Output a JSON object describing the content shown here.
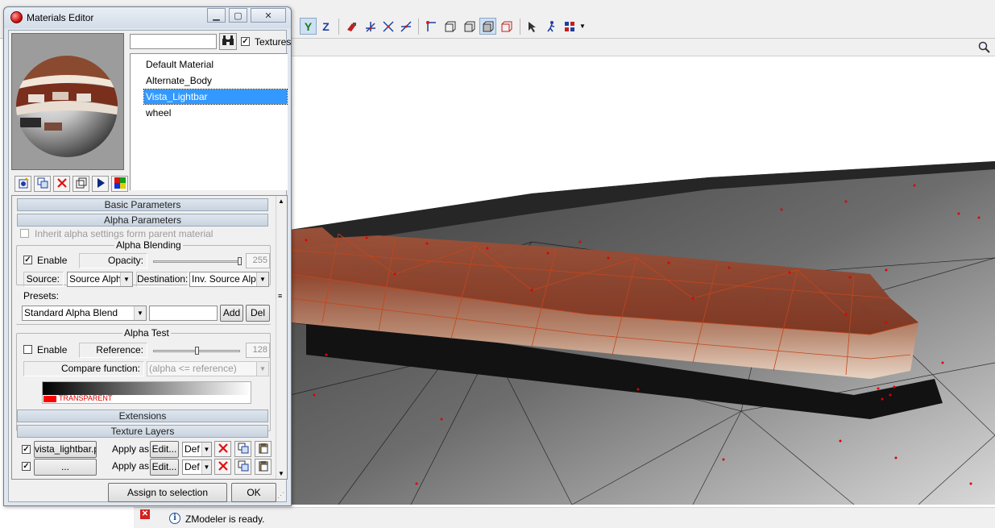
{
  "dialog": {
    "title": "Materials Editor",
    "search_value": "",
    "textures_label": "Textures",
    "textures_checked": true,
    "materials": [
      {
        "name": "Default Material",
        "selected": false
      },
      {
        "name": "Alternate_Body",
        "selected": false
      },
      {
        "name": "Vista_Lightbar",
        "selected": true
      },
      {
        "name": "wheel",
        "selected": false
      }
    ],
    "sections": {
      "basic": "Basic Parameters",
      "alpha": "Alpha Parameters",
      "extensions": "Extensions",
      "texture_layers": "Texture Layers"
    },
    "inherit_label": "Inherit alpha settings form parent material",
    "alpha_blending": {
      "title": "Alpha Blending",
      "enable_label": "Enable",
      "enabled": true,
      "opacity_label": "Opacity:",
      "opacity_value": "255",
      "opacity_level": 1.0,
      "source_label": "Source:",
      "source_value": "Source Alpha",
      "destination_label": "Destination:",
      "destination_value": "Inv. Source Alpha"
    },
    "presets": {
      "label": "Presets:",
      "selected": "Standard Alpha Blend",
      "name_value": "",
      "add_label": "Add",
      "del_label": "Del"
    },
    "alpha_test": {
      "title": "Alpha Test",
      "enable_label": "Enable",
      "enabled": false,
      "reference_label": "Reference:",
      "reference_value": "128",
      "reference_level": 0.5,
      "compare_label": "Compare function:",
      "compare_value": "(alpha <= reference)",
      "transparent_label": "TRANSPARENT"
    },
    "texture_layers": [
      {
        "file": "vista_lightbar.png",
        "checked": true,
        "apply_label": "Apply as:",
        "edit_label": "Edit...",
        "mode_value": "Def"
      },
      {
        "file": "...",
        "checked": true,
        "apply_label": "Apply as:",
        "edit_label": "Edit...",
        "mode_value": "Def"
      }
    ],
    "assign_label": "Assign to selection",
    "ok_label": "OK"
  },
  "app": {
    "status_text": "ZModeler is ready.",
    "axis_labels": {
      "y": "Y",
      "z": "Z"
    }
  },
  "colors": {
    "selection": "#3399ff",
    "section_bar": "#c8d3e0",
    "model_body": "#8b3b22",
    "vertex_dot": "#e00000"
  }
}
